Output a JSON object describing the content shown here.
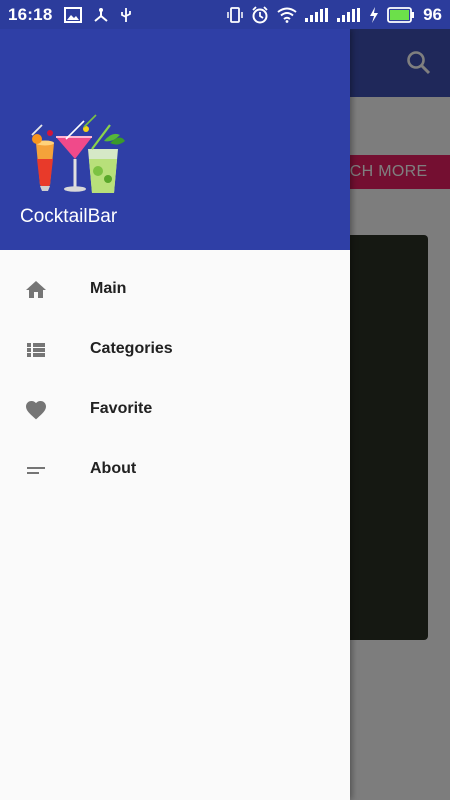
{
  "status_bar": {
    "time": "16:18",
    "battery_percent": "96"
  },
  "background": {
    "search_button_label": "EARCH MORE"
  },
  "drawer": {
    "app_name": "CocktailBar",
    "items": [
      {
        "label": "Main",
        "icon": "home-icon"
      },
      {
        "label": "Categories",
        "icon": "list-icon"
      },
      {
        "label": "Favorite",
        "icon": "heart-icon"
      },
      {
        "label": "About",
        "icon": "short-text-icon"
      }
    ]
  },
  "colors": {
    "primary": "#3f51b5",
    "accent": "#e91e63",
    "drawer_bg": "#fafafa"
  }
}
